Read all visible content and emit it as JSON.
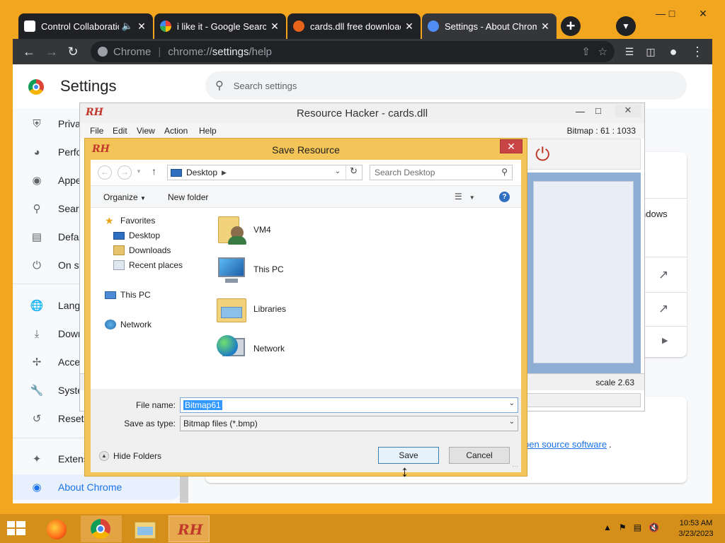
{
  "chrome": {
    "tabs": [
      {
        "title": "Control Collaboration",
        "favicon": "app-icon"
      },
      {
        "title": "i like it - Google Search",
        "favicon": "google-icon"
      },
      {
        "title": "cards.dll free download",
        "favicon": "gear-icon"
      },
      {
        "title": "Settings - About Chrome",
        "favicon": "settings-icon",
        "active": true
      }
    ],
    "omnibox": {
      "site_label": "Chrome",
      "url_scheme": "chrome://",
      "url_host": "settings",
      "url_path": "/help"
    }
  },
  "settings": {
    "title": "Settings",
    "search_placeholder": "Search settings",
    "nav_items": [
      {
        "label": "Priva",
        "icon": "shield-icon"
      },
      {
        "label": "Perfo",
        "icon": "speedometer-icon"
      },
      {
        "label": "Appe",
        "icon": "palette-icon"
      },
      {
        "label": "Searc",
        "icon": "search-icon"
      },
      {
        "label": "Defa",
        "icon": "browser-icon"
      },
      {
        "label": "On st",
        "icon": "power-icon"
      },
      {
        "label": "Lang",
        "icon": "globe-icon"
      },
      {
        "label": "Dowr",
        "icon": "download-icon"
      },
      {
        "label": "Acce",
        "icon": "accessibility-icon"
      },
      {
        "label": "Syste",
        "icon": "wrench-icon"
      },
      {
        "label": "Reset",
        "icon": "history-icon"
      },
      {
        "label": "Extens",
        "icon": "puzzle-icon"
      },
      {
        "label": "About Chrome",
        "icon": "chrome-icon",
        "active": true
      }
    ],
    "windows_fragment": "ndows",
    "oss_link": "pen source software",
    "oss_suffix": "."
  },
  "resource_hacker": {
    "title": "Resource Hacker - cards.dll",
    "logo": "RH",
    "menu": [
      "File",
      "Edit",
      "View",
      "Action",
      "Help"
    ],
    "status_top": "Bitmap : 61 : 1033",
    "scale": "scale 2.63"
  },
  "save_dialog": {
    "title": "Save Resource",
    "logo": "RH",
    "location": "Desktop",
    "search_placeholder": "Search Desktop",
    "organize": "Organize",
    "new_folder": "New folder",
    "tree": {
      "favorites": "Favorites",
      "desktop": "Desktop",
      "downloads": "Downloads",
      "recent": "Recent places",
      "this_pc": "This PC",
      "network": "Network"
    },
    "files": [
      {
        "name": "VM4",
        "icon": "user-folder-icon"
      },
      {
        "name": "This PC",
        "icon": "computer-icon"
      },
      {
        "name": "Libraries",
        "icon": "libraries-icon"
      },
      {
        "name": "Network",
        "icon": "network-globe-icon"
      }
    ],
    "file_name_label": "File name:",
    "file_name_value": "Bitmap61",
    "save_as_type_label": "Save as type:",
    "save_as_type_value": "Bitmap files (*.bmp)",
    "hide_folders": "Hide Folders",
    "save_label": "Save",
    "cancel_label": "Cancel"
  },
  "taskbar": {
    "apps": [
      "firefox-icon",
      "chrome-icon",
      "file-explorer-icon",
      "resource-hacker-icon"
    ],
    "active_app": "resource-hacker-icon",
    "time": "10:53 AM",
    "date": "3/23/2023"
  }
}
